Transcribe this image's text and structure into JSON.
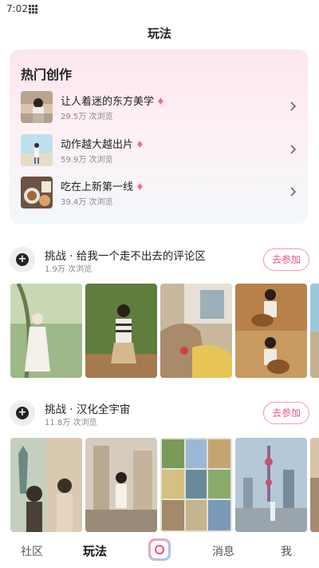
{
  "status": {
    "time": "7:02"
  },
  "header": {
    "title": "玩法"
  },
  "hot": {
    "title": "热门创作",
    "items": [
      {
        "name": "让人着迷的东方美学",
        "views": "29.5万 次浏览"
      },
      {
        "name": "动作越大越出片",
        "views": "59.9万 次浏览"
      },
      {
        "name": "吃在上新第一线",
        "views": "39.4万 次浏览"
      }
    ]
  },
  "challenges": [
    {
      "title": "挑战 · 给我一个走不出去的评论区",
      "views": "1.9万 次浏览",
      "join": "去参加"
    },
    {
      "title": "挑战 · 汉化全宇宙",
      "views": "11.8万 次浏览",
      "join": "去参加"
    }
  ],
  "tabs": {
    "community": "社区",
    "play": "玩法",
    "messages": "消息",
    "me": "我"
  },
  "colors": {
    "accent": "#f0517b",
    "flame": "#ff6b8a"
  }
}
